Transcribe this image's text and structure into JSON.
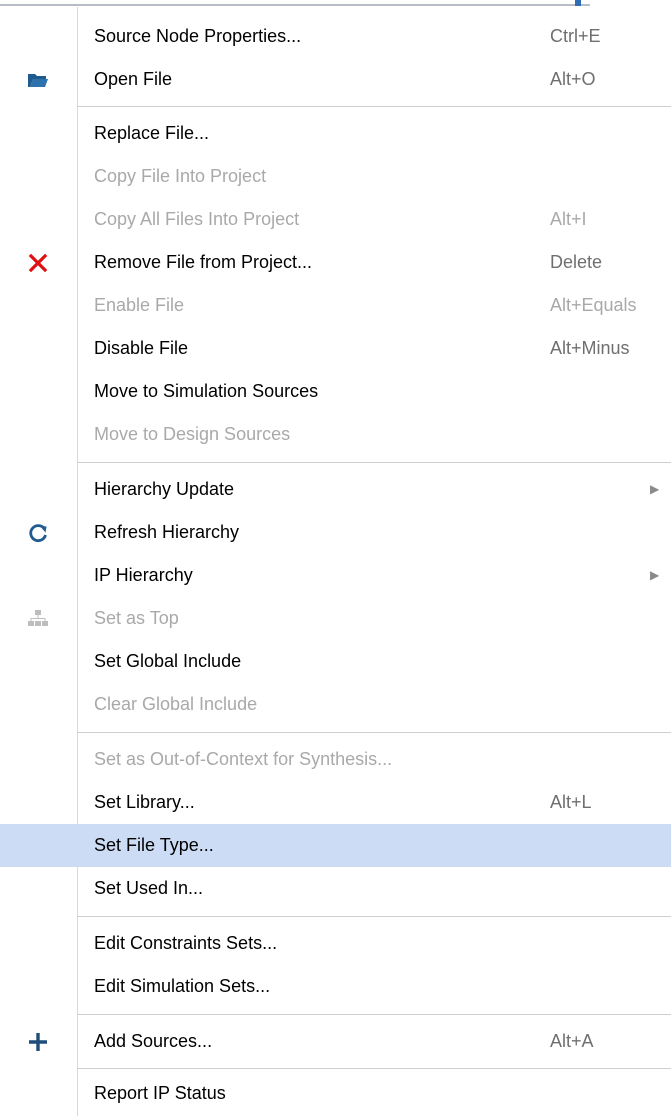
{
  "menu": {
    "items": [
      {
        "label": "Source Node Properties...",
        "shortcut": "Ctrl+E"
      },
      {
        "label": "Open File",
        "shortcut": "Alt+O",
        "icon": "folder-open-icon"
      },
      {
        "label": "Replace File...",
        "shortcut": ""
      },
      {
        "label": "Copy File Into Project",
        "shortcut": "",
        "disabled": true
      },
      {
        "label": "Copy All Files Into Project",
        "shortcut": "Alt+I",
        "disabled": true
      },
      {
        "label": "Remove File from Project...",
        "shortcut": "Delete",
        "icon": "remove-x-icon"
      },
      {
        "label": "Enable File",
        "shortcut": "Alt+Equals",
        "disabled": true
      },
      {
        "label": "Disable File",
        "shortcut": "Alt+Minus"
      },
      {
        "label": "Move to Simulation Sources",
        "shortcut": ""
      },
      {
        "label": "Move to Design Sources",
        "shortcut": "",
        "disabled": true
      },
      {
        "label": "Hierarchy Update",
        "shortcut": "",
        "submenu": true
      },
      {
        "label": "Refresh Hierarchy",
        "shortcut": "",
        "icon": "refresh-icon"
      },
      {
        "label": "IP Hierarchy",
        "shortcut": "",
        "submenu": true
      },
      {
        "label": "Set as Top",
        "shortcut": "",
        "disabled": true,
        "icon": "set-top-icon"
      },
      {
        "label": "Set Global Include",
        "shortcut": ""
      },
      {
        "label": "Clear Global Include",
        "shortcut": "",
        "disabled": true
      },
      {
        "label": "Set as Out-of-Context for Synthesis...",
        "shortcut": "",
        "disabled": true
      },
      {
        "label": "Set Library...",
        "shortcut": "Alt+L"
      },
      {
        "label": "Set File Type...",
        "shortcut": "",
        "highlighted": true
      },
      {
        "label": "Set Used In...",
        "shortcut": ""
      },
      {
        "label": "Edit Constraints Sets...",
        "shortcut": ""
      },
      {
        "label": "Edit Simulation Sets...",
        "shortcut": ""
      },
      {
        "label": "Add Sources...",
        "shortcut": "Alt+A",
        "icon": "add-plus-icon"
      },
      {
        "label": "Report IP Status",
        "shortcut": ""
      }
    ]
  },
  "colors": {
    "highlight": "#cddcf5",
    "disabled_text": "#a9a9a9",
    "remove_icon": "#e01010",
    "folder_icon": "#1f5b8f"
  }
}
